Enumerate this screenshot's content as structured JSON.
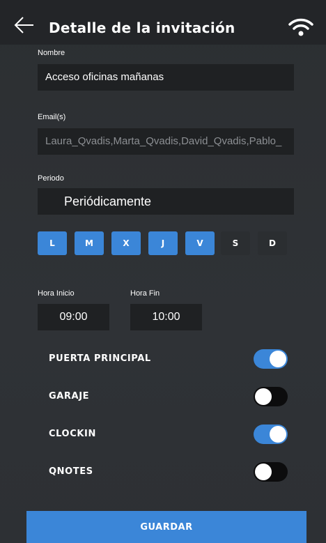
{
  "header": {
    "title": "Detalle de la invitación",
    "back_icon": "arrow-left-icon",
    "status_icon": "wifi-icon"
  },
  "form": {
    "name_label": "Nombre",
    "name_value": "Acceso oficinas mañanas",
    "emails_label": "Email(s)",
    "emails_value": "Laura_Qvadis,Marta_Qvadis,David_Qvadis,Pablo_",
    "period_label": "Periodo",
    "period_value": "Periódicamente",
    "days": [
      {
        "label": "L",
        "active": true
      },
      {
        "label": "M",
        "active": true
      },
      {
        "label": "X",
        "active": true
      },
      {
        "label": "J",
        "active": true
      },
      {
        "label": "V",
        "active": true
      },
      {
        "label": "S",
        "active": false
      },
      {
        "label": "D",
        "active": false
      }
    ],
    "start_label": "Hora Inicio",
    "start_value": "09:00",
    "end_label": "Hora Fin",
    "end_value": "10:00"
  },
  "doors": [
    {
      "label": "PUERTA PRINCIPAL",
      "enabled": true
    },
    {
      "label": "GARAJE",
      "enabled": false
    },
    {
      "label": "CLOCKIN",
      "enabled": true
    },
    {
      "label": "QNOTES",
      "enabled": false
    }
  ],
  "actions": {
    "save_label": "GUARDAR"
  },
  "colors": {
    "accent": "#3b86d8",
    "background": "#2d3034",
    "field": "#1f2123",
    "toggle_off": "#0c0c0d"
  }
}
